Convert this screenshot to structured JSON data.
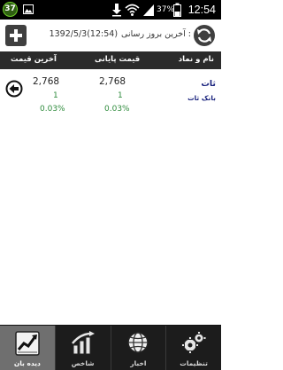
{
  "status_bar": {
    "notification_count": "37",
    "battery_percent": "37%",
    "time": "12:54",
    "icons": [
      "notification-badge-icon",
      "image-icon",
      "download-icon",
      "wifi-icon",
      "signal-icon",
      "battery-icon"
    ]
  },
  "header": {
    "last_update_label": "آخرین بروز رسانی :",
    "last_update_value": "1392/5/3(12:54)",
    "add_icon": "plus-icon",
    "refresh_icon": "refresh-icon"
  },
  "columns": {
    "name_symbol": "نام و نماد",
    "final_price": "قیمت پایانی",
    "last_price": "آخرین قیمت"
  },
  "rows": [
    {
      "symbol": "ثات",
      "full_name": "بانک ثات",
      "last_price": "2,768",
      "last_change": "1",
      "last_percent": "0.03%",
      "final_price": "2,768",
      "final_change": "1",
      "final_percent": "0.03%"
    }
  ],
  "tabs": [
    {
      "label": "دیده بان",
      "icon": "chart-line-icon",
      "active": true
    },
    {
      "label": "شاخص",
      "icon": "bar-chart-icon",
      "active": false
    },
    {
      "label": "اخبار",
      "icon": "globe-icon",
      "active": false
    },
    {
      "label": "تنظیمات",
      "icon": "gears-icon",
      "active": false
    }
  ],
  "colors": {
    "status_bar_bg": "#000000",
    "column_bar_bg": "#2b2b2b",
    "change_green": "#2e8b3c",
    "symbol_blue": "#1a237e",
    "tab_bar_bg": "#1c1c1c",
    "tab_active_bg": "#6f6f6f"
  }
}
